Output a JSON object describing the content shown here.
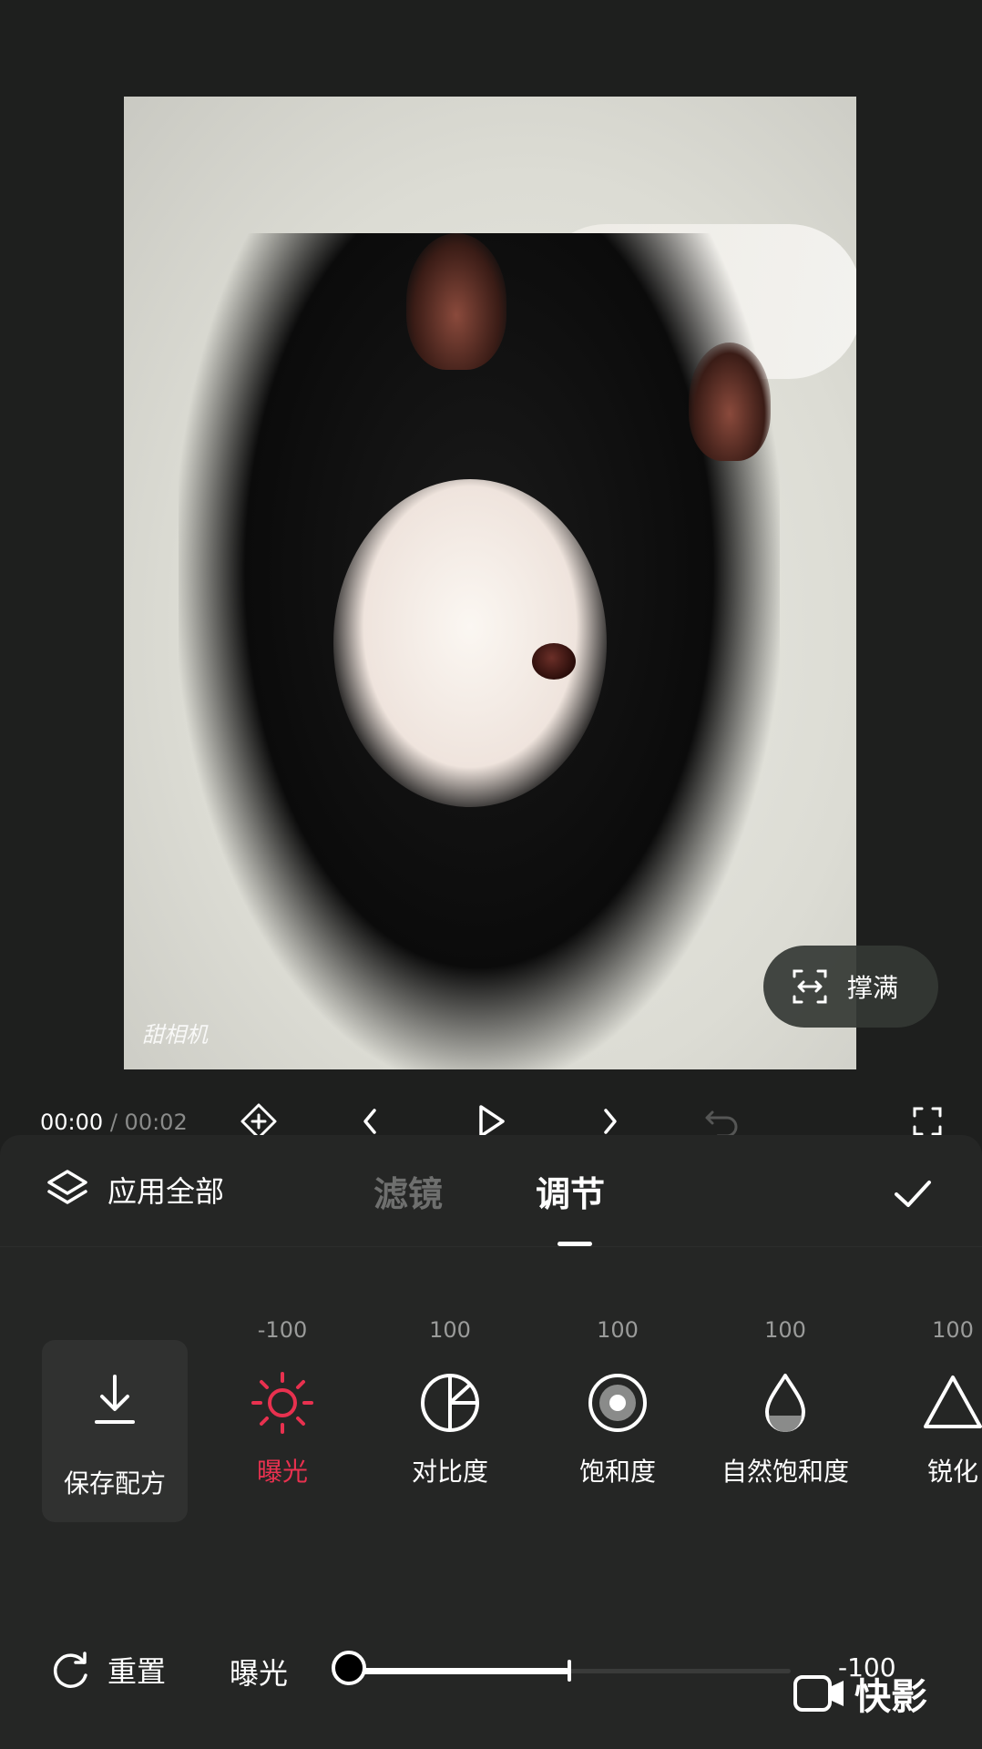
{
  "preview": {
    "camera_watermark": "甜相机",
    "fill_button_label": "撑满"
  },
  "playback": {
    "current_time": "00:00",
    "separator": "/",
    "total_time": "00:02"
  },
  "panel": {
    "apply_all_label": "应用全部",
    "tabs": [
      {
        "label": "滤镜",
        "active": false
      },
      {
        "label": "调节",
        "active": true
      }
    ]
  },
  "tools": {
    "save_recipe_label": "保存配方",
    "items": [
      {
        "label": "曝光",
        "value": "-100",
        "icon": "sun-icon",
        "active": true
      },
      {
        "label": "对比度",
        "value": "100",
        "icon": "contrast-icon",
        "active": false
      },
      {
        "label": "饱和度",
        "value": "100",
        "icon": "saturation-icon",
        "active": false
      },
      {
        "label": "自然饱和度",
        "value": "100",
        "icon": "drop-icon",
        "active": false
      },
      {
        "label": "锐化",
        "value": "100",
        "icon": "triangle-icon",
        "active": false
      }
    ]
  },
  "slider": {
    "reset_label": "重置",
    "name": "曝光",
    "value": "-100",
    "min": -100,
    "max": 100,
    "position_fraction": 0.0
  },
  "brand": {
    "label": "快影"
  },
  "colors": {
    "accent": "#e8314f",
    "panel_bg": "#252625",
    "page_bg": "#1e1f1e"
  }
}
